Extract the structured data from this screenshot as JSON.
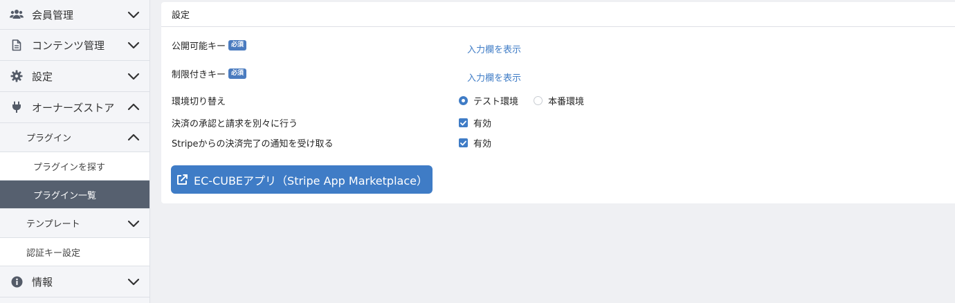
{
  "sidebar": {
    "items": [
      {
        "label": "会員管理",
        "icon": "users-icon",
        "expanded": false
      },
      {
        "label": "コンテンツ管理",
        "icon": "file-icon",
        "expanded": false
      },
      {
        "label": "設定",
        "icon": "gear-icon",
        "expanded": false
      },
      {
        "label": "オーナーズストア",
        "icon": "plug-icon",
        "expanded": true
      }
    ],
    "sub": {
      "plugin": "プラグイン",
      "find_plugin": "プラグインを探す",
      "plugin_list": "プラグイン一覧",
      "template": "テンプレート",
      "auth_key": "認証キー設定"
    },
    "info": {
      "label": "情報",
      "icon": "info-icon"
    }
  },
  "card": {
    "title": "設定",
    "required_badge": "必須",
    "publishable_key_label": "公開可能キー",
    "restricted_key_label": "制限付きキー",
    "show_input_link": "入力欄を表示",
    "env_label": "環境切り替え",
    "env_options": [
      "テスト環境",
      "本番環境"
    ],
    "env_selected": "テスト環境",
    "separate_auth_label": "決済の承認と請求を別々に行う",
    "notify_label": "Stripeからの決済完了の通知を受け取る",
    "enabled_label": "有効",
    "app_button": "EC-CUBEアプリ（Stripe App Marketplace）"
  },
  "colors": {
    "accent": "#3f7cc6",
    "sidebar_active": "#56606f",
    "sidebar_bg": "#f4f5f8",
    "page_bg": "#eff0f3"
  }
}
